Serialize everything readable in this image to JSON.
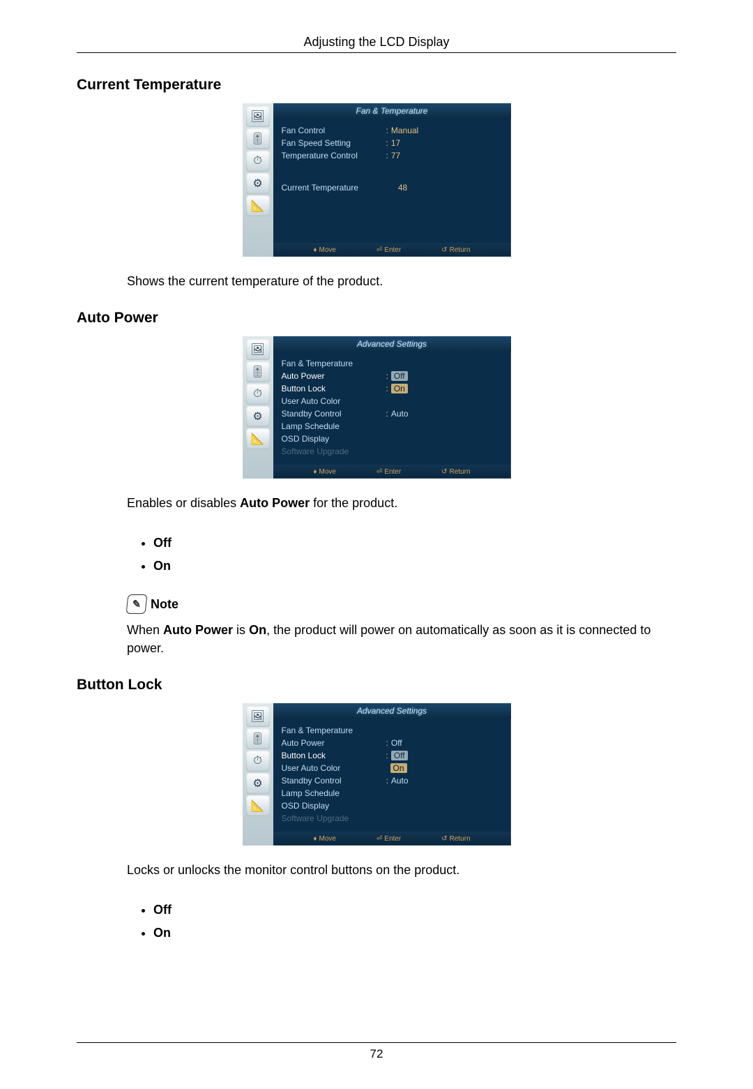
{
  "header": "Adjusting the LCD Display",
  "page_number": "72",
  "sections": [
    {
      "title": "Current Temperature",
      "desc": "Shows the current temperature of the product."
    },
    {
      "title": "Auto Power",
      "desc_html": "Enables or disables <b>Auto Power</b> for the product.",
      "options": [
        "Off",
        "On"
      ],
      "note_label": "Note",
      "note_html": "When <b>Auto Power</b> is <b>On</b>, the product will power on automatically as soon as it is connected to power."
    },
    {
      "title": "Button Lock",
      "desc_html": "Locks or unlocks the monitor control buttons on the product.",
      "options": [
        "Off",
        "On"
      ]
    }
  ],
  "osd_footer": {
    "move": "Move",
    "enter": "Enter",
    "return": "Return"
  },
  "osd1": {
    "title": "Fan & Temperature",
    "rows": [
      {
        "lab": "Fan Control",
        "val": "Manual"
      },
      {
        "lab": "Fan Speed Setting",
        "val": "17"
      },
      {
        "lab": "Temperature Control",
        "val": "77"
      }
    ],
    "current_lab": "Current Temperature",
    "current_val": "48"
  },
  "osd2": {
    "title": "Advanced Settings",
    "rows": [
      {
        "lab": "Fan & Temperature",
        "val": ""
      },
      {
        "lab": "Auto Power",
        "val": "Off",
        "sel": true,
        "cursor": true
      },
      {
        "lab": "Button Lock",
        "val": "On",
        "sel": true,
        "selbox_on": true
      },
      {
        "lab": "User Auto Color",
        "val": ""
      },
      {
        "lab": "Standby Control",
        "val": "Auto"
      },
      {
        "lab": "Lamp Schedule",
        "val": ""
      },
      {
        "lab": "OSD Display",
        "val": ""
      },
      {
        "lab": "Software Upgrade",
        "val": "",
        "dim": true
      }
    ]
  },
  "osd3": {
    "title": "Advanced Settings",
    "rows": [
      {
        "lab": "Fan & Temperature",
        "val": ""
      },
      {
        "lab": "Auto Power",
        "val": "Off"
      },
      {
        "lab": "Button Lock",
        "val": "Off",
        "sel": true,
        "cursor": true
      },
      {
        "lab": "User Auto Color",
        "val": "On",
        "selbox_on": true
      },
      {
        "lab": "Standby Control",
        "val": "Auto"
      },
      {
        "lab": "Lamp Schedule",
        "val": ""
      },
      {
        "lab": "OSD Display",
        "val": ""
      },
      {
        "lab": "Software Upgrade",
        "val": "",
        "dim": true
      }
    ]
  },
  "sidebar_icons": [
    "🖼",
    "🎚",
    "⏱",
    "⚙",
    "📐"
  ]
}
